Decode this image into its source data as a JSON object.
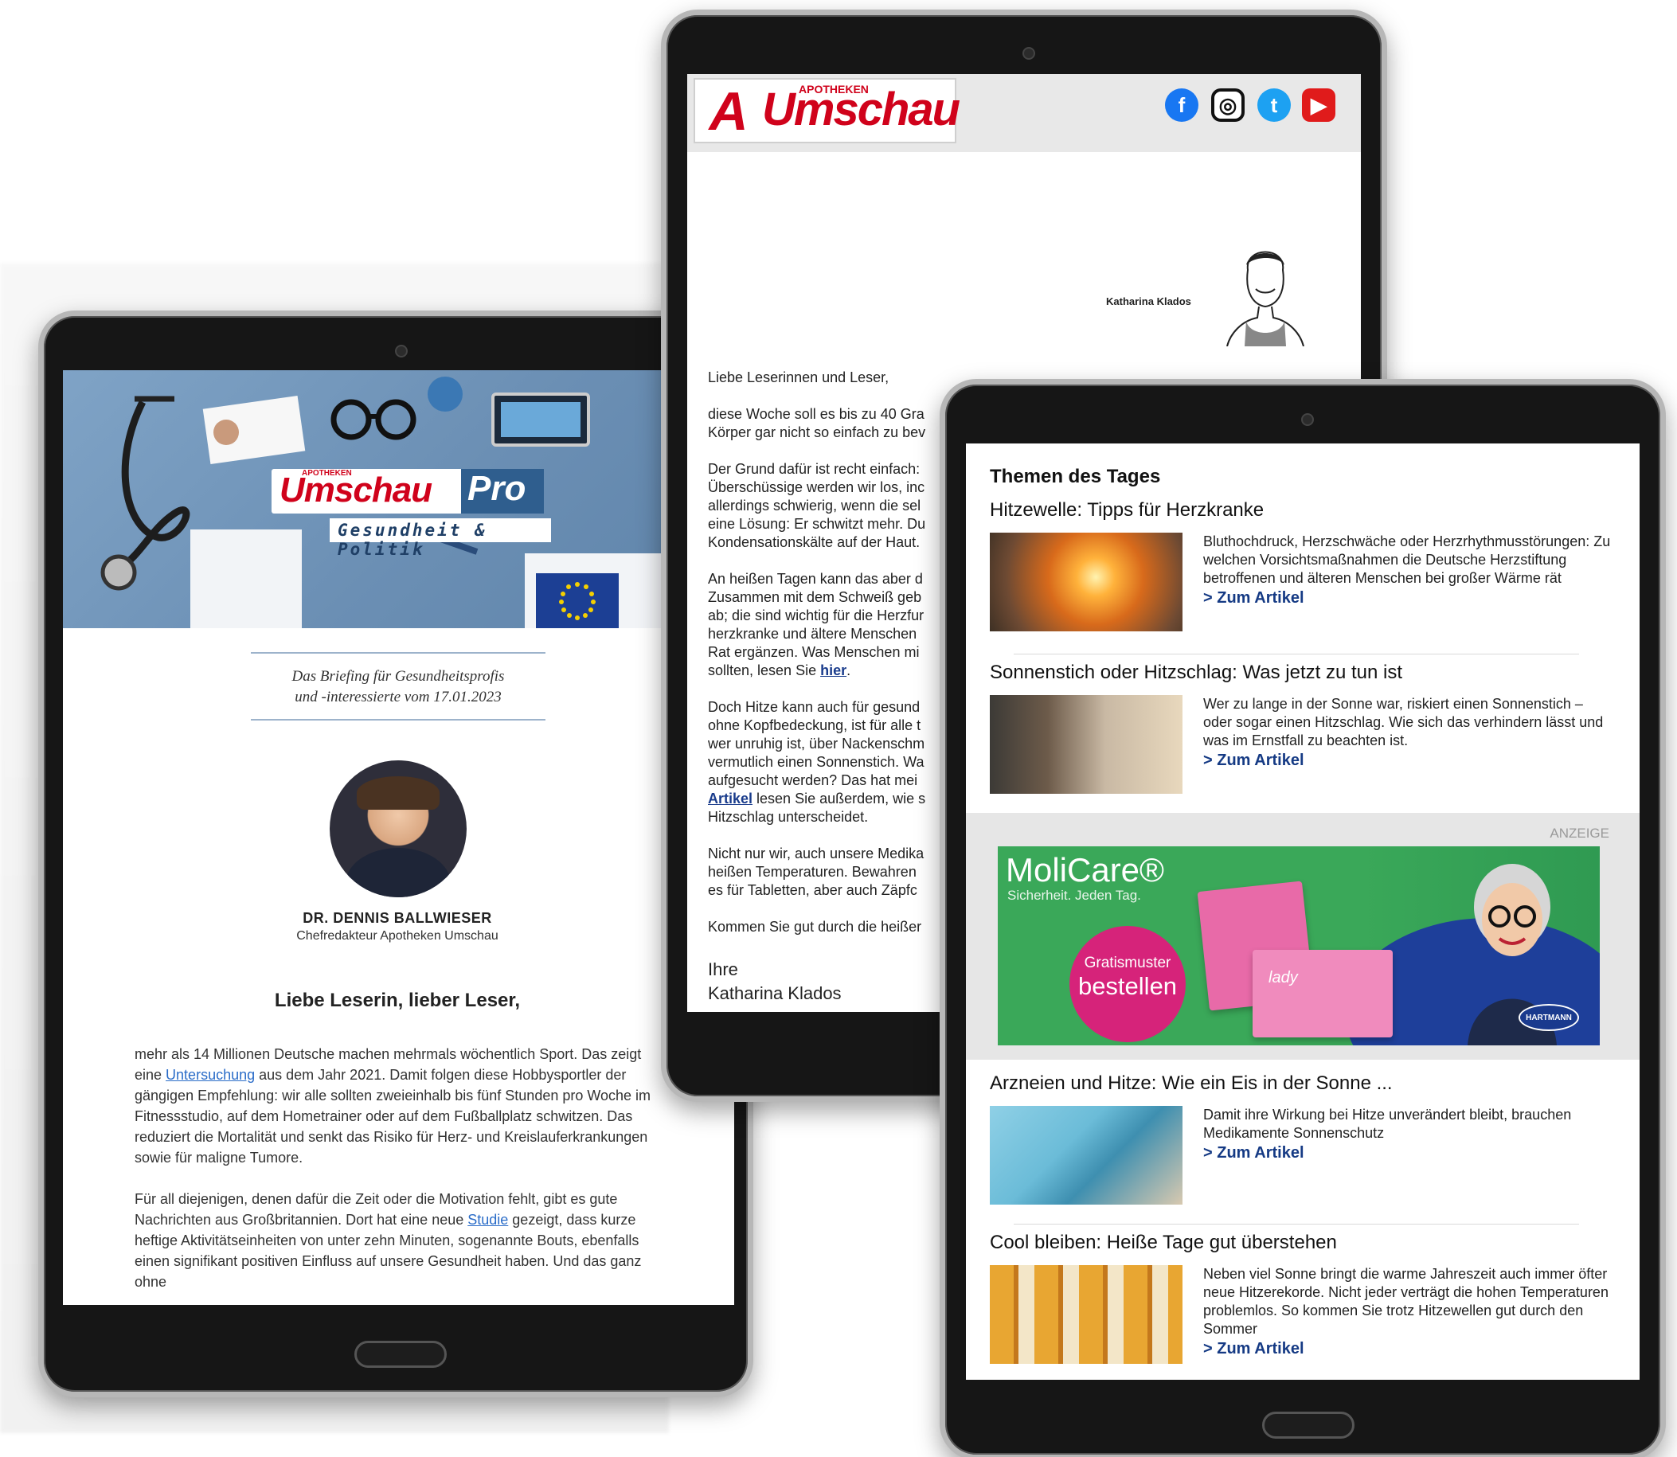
{
  "tablet_left": {
    "logo": {
      "apotheken": "APOTHEKEN",
      "umschau": "Umschau",
      "pro": "Pro",
      "tagline": "Gesundheit & Politik"
    },
    "briefing_line1": "Das Briefing für Gesundheitsprofis",
    "briefing_line2": "und -interessierte vom 17.01.2023",
    "author_name": "DR. DENNIS BALLWIESER",
    "author_role": "Chefredakteur Apotheken Umschau",
    "greeting": "Liebe Leserin, lieber Leser,",
    "p1_a": "mehr als 14 Millionen Deutsche machen mehrmals wöchentlich Sport. Das zeigt eine ",
    "p1_link": "Untersuchung",
    "p1_b": " aus dem Jahr 2021. Damit folgen diese Hobbysportler der gängigen Empfehlung: wir alle sollten zweieinhalb bis fünf Stunden pro Woche im Fitnessstudio, auf dem Hometrainer oder auf dem Fußballplatz schwitzen. Das reduziert die Mortalität und senkt das Risiko für Herz- und Kreislauferkrankungen sowie für maligne Tumore.",
    "p2_a": "Für all diejenigen, denen dafür die Zeit oder die Motivation fehlt, gibt es gute Nachrichten aus Großbritannien. Dort hat eine neue ",
    "p2_link": "Studie",
    "p2_b": " gezeigt, dass kurze heftige Aktivitätseinheiten von unter zehn Minuten, sogenannte Bouts, ebenfalls einen signifikant positiven Einfluss auf unsere Gesundheit haben. Und das ganz ohne"
  },
  "tablet_middle": {
    "logo": {
      "apotheken": "APOTHEKEN",
      "umschau": "Umschau"
    },
    "signature_name": "Katharina Klados",
    "salutation": "Liebe Leserinnen und Leser,",
    "p1": "diese Woche soll es bis zu 40 Gra\nKörper gar nicht so einfach zu bev",
    "p2": "Der Grund dafür ist recht einfach:\nÜberschüssige werden wir los, inc\nallerdings schwierig, wenn die sel\neine Lösung: Er schwitzt mehr. Du\nKondensationskälte auf der Haut.",
    "p3_a": "An heißen Tagen kann das aber d\nZusammen mit dem Schweiß geb\nab; die sind wichtig für die Herzfur\nherzkranke und ältere Menschen\nRat ergänzen. Was Menschen mi\nsollten, lesen Sie ",
    "p3_link": "hier",
    "p3_b": ".",
    "p4_a": "Doch Hitze kann auch für gesund\nohne Kopfbedeckung, ist für alle t\nwer unruhig ist, über Nackenschm\nvermutlich einen Sonnenstich. Wa\naufgesucht werden? Das hat mei\n",
    "p4_link": "Artikel",
    "p4_b": " lesen Sie außerdem, wie s\nHitzschlag unterscheidet.",
    "p5": "Nicht nur wir, auch unsere Medika\nheißen Temperaturen. Bewahren\nes für Tabletten, aber auch Zäpfc",
    "p6": "Kommen Sie gut durch die heißer",
    "closing_1": "Ihre",
    "closing_2": "Katharina Klados",
    "social": {
      "facebook": "f",
      "instagram": "◎",
      "twitter": "t",
      "youtube": "▶"
    }
  },
  "tablet_right": {
    "section_title": "Themen des Tages",
    "link_label": "> Zum Artikel",
    "articles": [
      {
        "title": "Hitzewelle: Tipps für Herzkranke",
        "text": "Bluthochdruck, Herzschwäche oder Herzrhythmusstörungen: Zu welchen Vorsichtsmaßnahmen die Deutsche Herzstiftung betroffenen und älteren Menschen bei großer Wärme rät"
      },
      {
        "title": "Sonnenstich oder Hitzschlag: Was jetzt zu tun ist",
        "text": "Wer zu lange in der Sonne war, riskiert einen Sonnenstich – oder sogar einen Hitzschlag. Wie sich das verhindern lässt und was im Ernstfall zu beachten ist."
      },
      {
        "title": "Arzneien und Hitze: Wie ein Eis in der Sonne ...",
        "text": "Damit ihre Wirkung bei Hitze unverändert bleibt, brauchen Medikamente Sonnenschutz"
      },
      {
        "title": "Cool bleiben: Heiße Tage gut überstehen",
        "text": "Neben viel Sonne bringt die warme Jahreszeit auch immer öfter neue Hitzerekorde. Nicht jeder verträgt die hohen Temperaturen problemlos. So kommen Sie trotz Hitzewellen gut durch den Sommer"
      }
    ],
    "ad": {
      "label": "ANZEIGE",
      "brand": "MoliCare®",
      "tagline": "Sicherheit. Jeden Tag.",
      "cta_line1": "Gratismuster",
      "cta_line2": "bestellen",
      "pack_label": "lady",
      "maker": "HARTMANN"
    }
  },
  "colors": {
    "brand_red": "#d0021b",
    "link_blue": "#153a84",
    "ad_green": "#3aa859",
    "ad_pink": "#d6237a"
  }
}
